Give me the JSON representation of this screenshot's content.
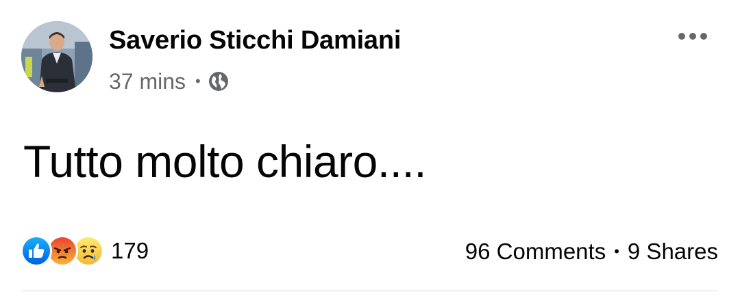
{
  "post": {
    "author_name": "Saverio Sticchi Damiani",
    "timestamp": "37 mins",
    "separator": "•",
    "audience_icon": "globe-icon",
    "more_icon": "more-options-icon",
    "text": "Tutto molto chiaro...."
  },
  "footer": {
    "reactions": [
      {
        "name": "like-reaction-icon",
        "color": "#1877f2"
      },
      {
        "name": "angry-reaction-icon",
        "color": "#f0612b"
      },
      {
        "name": "sad-reaction-icon",
        "color": "#f7c73b"
      }
    ],
    "reaction_count": "179",
    "comments": "96 Comments",
    "separator": "•",
    "shares": "9 Shares"
  },
  "colors": {
    "primary_text": "#050505",
    "secondary_text": "#65676b",
    "divider": "#dadde1"
  }
}
